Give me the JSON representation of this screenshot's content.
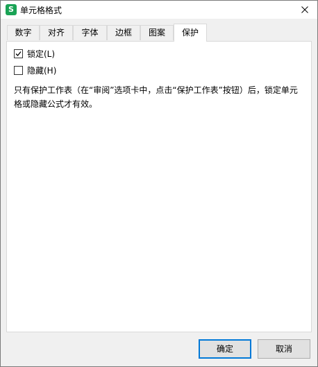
{
  "window": {
    "title": "单元格格式",
    "app_icon_glyph": "S",
    "app_icon_color": "#1aa355"
  },
  "tabs": [
    {
      "label": "数字",
      "active": false
    },
    {
      "label": "对齐",
      "active": false
    },
    {
      "label": "字体",
      "active": false
    },
    {
      "label": "边框",
      "active": false
    },
    {
      "label": "图案",
      "active": false
    },
    {
      "label": "保护",
      "active": true
    }
  ],
  "protection": {
    "locked": {
      "label": "锁定(L)",
      "checked": true
    },
    "hidden": {
      "label": "隐藏(H)",
      "checked": false
    },
    "description": "只有保护工作表（在“审阅”选项卡中，点击“保护工作表”按钮）后，锁定单元格或隐藏公式才有效。"
  },
  "buttons": {
    "ok": "确定",
    "cancel": "取消"
  },
  "colors": {
    "accent": "#0078d7"
  }
}
